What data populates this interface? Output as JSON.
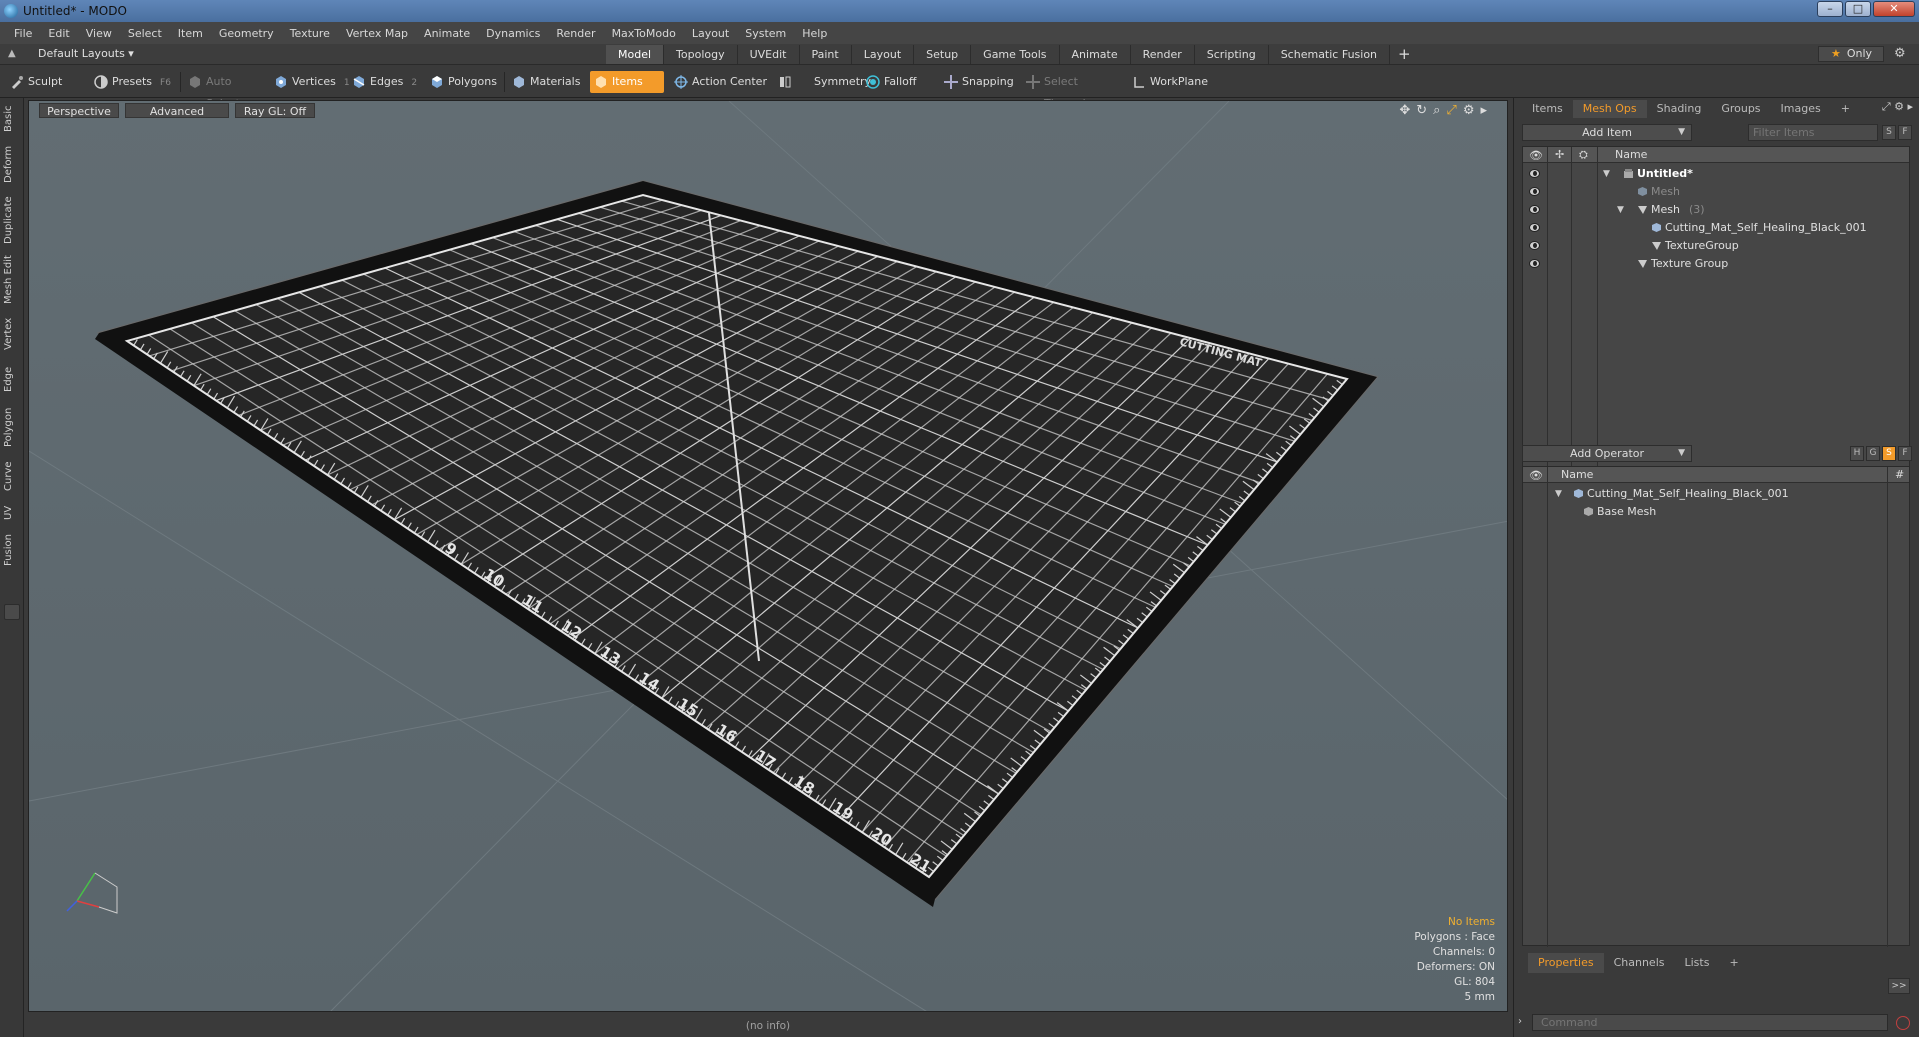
{
  "window": {
    "title": "Untitled* - MODO",
    "minimize": "–",
    "maximize": "□",
    "close": "✕"
  },
  "menu": [
    "File",
    "Edit",
    "View",
    "Select",
    "Item",
    "Geometry",
    "Texture",
    "Vertex Map",
    "Animate",
    "Dynamics",
    "Render",
    "MaxToModo",
    "Layout",
    "System",
    "Help"
  ],
  "layoutbar": {
    "layout_select": "Default Layouts ▾",
    "tabs": [
      "Model",
      "Topology",
      "UVEdit",
      "Paint",
      "Layout",
      "Setup",
      "Game Tools",
      "Animate",
      "Render",
      "Scripting",
      "Schematic Fusion"
    ],
    "active_tab": "Model",
    "plus": "+",
    "only_label": "Only"
  },
  "toolbar": {
    "sculpt": "Sculpt",
    "presets": "Presets",
    "presets_hotkey": "F6",
    "auto_select": "Auto Select",
    "vertices": "Vertices",
    "vertices_hotkey": "1",
    "edges": "Edges",
    "edges_hotkey": "2",
    "polygons": "Polygons",
    "materials": "Materials",
    "items": "Items",
    "action_center": "Action Center",
    "symmetry": "Symmetry",
    "falloff": "Falloff",
    "snapping": "Snapping",
    "select_through": "Select Through",
    "workplane": "WorkPlane"
  },
  "left_tabs": [
    "Basic",
    "Deform",
    "Duplicate",
    "Mesh Edit",
    "Vertex",
    "Edge",
    "Polygon",
    "Curve",
    "UV",
    "Fusion"
  ],
  "viewport": {
    "perspective": "Perspective",
    "advanced": "Advanced",
    "raygl": "Ray GL: Off",
    "info": {
      "no_items": "No Items",
      "polygons": "Polygons : Face",
      "channels": "Channels: 0",
      "deformers": "Deformers: ON",
      "gl": "GL: 804",
      "unit": "5 mm"
    },
    "mat_title": "CUTTING MAT",
    "ruler_numbers": [
      "9",
      "10",
      "11",
      "12",
      "13",
      "14",
      "15",
      "16",
      "17",
      "18",
      "19",
      "20",
      "21"
    ]
  },
  "status": {
    "info": "(no info)"
  },
  "items_panel": {
    "tabs": [
      "Items",
      "Mesh Ops",
      "Shading",
      "Groups",
      "Images",
      "+"
    ],
    "active_tab": "Mesh Ops",
    "add_item": "Add Item",
    "filter_placeholder": "Filter Items",
    "s_btn": "S",
    "f_btn": "F",
    "col_name": "Name",
    "rows": [
      {
        "label": "Untitled*"
      },
      {
        "label": "Mesh"
      },
      {
        "label": "Mesh",
        "count": "(3)"
      },
      {
        "label": "Cutting_Mat_Self_Healing_Black_001"
      },
      {
        "label": "TextureGroup"
      },
      {
        "label": "Texture Group"
      }
    ]
  },
  "meshops_panel": {
    "add_operator": "Add Operator",
    "h_btn": "H",
    "g_btn": "G",
    "s_btn": "S",
    "f_btn": "F",
    "col_name": "Name",
    "col_hash": "#",
    "rows": [
      {
        "label": "Cutting_Mat_Self_Healing_Black_001"
      },
      {
        "label": "Base Mesh"
      }
    ]
  },
  "bottom_panel": {
    "tabs": [
      "Properties",
      "Channels",
      "Lists",
      "+"
    ],
    "active_tab": "Properties",
    "expand": ">>",
    "command_placeholder": "Command"
  }
}
